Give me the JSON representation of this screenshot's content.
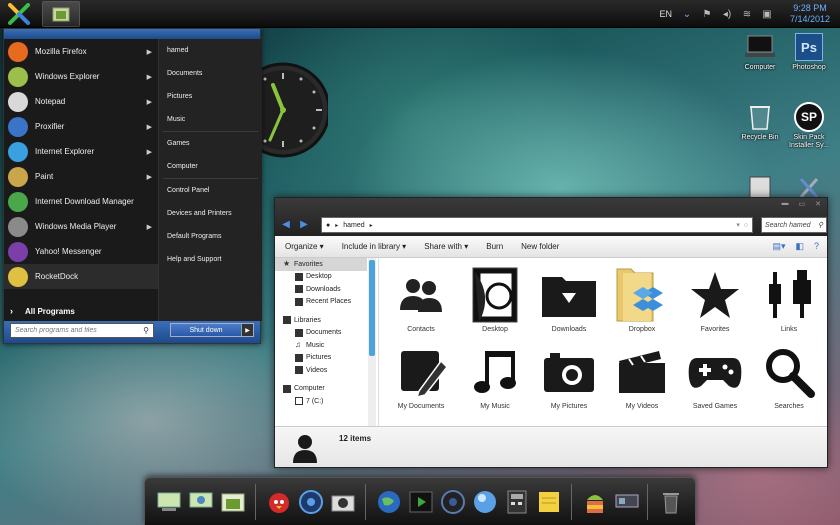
{
  "taskbar": {
    "start_icon": "colorful-x-icon",
    "app_icon": "folder-icon"
  },
  "tray": {
    "language": "EN",
    "time": "9:28 PM",
    "date": "7/14/2012"
  },
  "start_menu": {
    "programs": [
      {
        "label": "Mozilla Firefox",
        "icon": "firefox-icon",
        "color": "#e66a1f",
        "arrow": true
      },
      {
        "label": "Windows Explorer",
        "icon": "explorer-icon",
        "color": "#9bbf4a",
        "arrow": true
      },
      {
        "label": "Notepad",
        "icon": "notepad-icon",
        "color": "#d9d9d9",
        "arrow": true
      },
      {
        "label": "Proxifier",
        "icon": "proxifier-icon",
        "color": "#3a74c7",
        "arrow": true
      },
      {
        "label": "Internet Explorer",
        "icon": "ie-icon",
        "color": "#3aa0e0",
        "arrow": true
      },
      {
        "label": "Paint",
        "icon": "paint-icon",
        "color": "#c9a64a",
        "arrow": true
      },
      {
        "label": "Internet Download Manager",
        "icon": "idm-icon",
        "color": "#4aa84a",
        "arrow": false
      },
      {
        "label": "Windows Media Player",
        "icon": "wmp-icon",
        "color": "#8a8a8a",
        "arrow": true
      },
      {
        "label": "Yahoo! Messenger",
        "icon": "yahoo-icon",
        "color": "#7a3fa8",
        "arrow": false
      },
      {
        "label": "RocketDock",
        "icon": "rocketdock-icon",
        "color": "#e0c040",
        "arrow": false
      }
    ],
    "all_programs": "All Programs",
    "places": [
      "hamed",
      "Documents",
      "Pictures",
      "Music",
      "Games",
      "Computer",
      "Control Panel",
      "Devices and Printers",
      "Default Programs",
      "Help and Support"
    ],
    "search_placeholder": "Search programs and files",
    "shutdown_label": "Shut down"
  },
  "desktop_icons": [
    {
      "label": "Computer",
      "icon": "laptop-icon"
    },
    {
      "label": "Photoshop",
      "icon": "photoshop-icon",
      "short": "Ps"
    },
    {
      "label": "Recycle Bin",
      "icon": "recycle-bin-icon"
    },
    {
      "label": "Skin Pack Installer Sy...",
      "icon": "skinpack-icon",
      "short": "SP"
    }
  ],
  "explorer": {
    "address_user": "hamed",
    "search_placeholder": "Search hamed",
    "commands": [
      "Organize ▾",
      "Include in library ▾",
      "Share with ▾",
      "Burn",
      "New folder"
    ],
    "nav_pane": {
      "favorites": "Favorites",
      "favorites_items": [
        "Desktop",
        "Downloads",
        "Recent Places"
      ],
      "libraries": "Libraries",
      "libraries_items": [
        "Documents",
        "Music",
        "Pictures",
        "Videos"
      ],
      "computer": "Computer",
      "computer_items": [
        "7 (C:)"
      ]
    },
    "items": [
      {
        "label": "Contacts",
        "icon": "contacts-icon"
      },
      {
        "label": "Desktop",
        "icon": "desktop-folder-icon"
      },
      {
        "label": "Downloads",
        "icon": "downloads-icon"
      },
      {
        "label": "Dropbox",
        "icon": "dropbox-icon"
      },
      {
        "label": "Favorites",
        "icon": "favorites-star-icon"
      },
      {
        "label": "Links",
        "icon": "links-icon"
      },
      {
        "label": "My Documents",
        "icon": "documents-icon"
      },
      {
        "label": "My Music",
        "icon": "music-icon"
      },
      {
        "label": "My Pictures",
        "icon": "pictures-icon"
      },
      {
        "label": "My Videos",
        "icon": "videos-icon"
      },
      {
        "label": "Saved Games",
        "icon": "games-icon"
      },
      {
        "label": "Searches",
        "icon": "search-icon"
      }
    ],
    "status": "12 items"
  },
  "dock": {
    "items": [
      "computer-dock-icon",
      "network-dock-icon",
      "folder-dock-icon",
      "angry-birds-icon",
      "browser-dock-icon",
      "camera-dock-icon",
      "globe-dock-icon",
      "media-player-dock-icon",
      "speaker-dock-icon",
      "orb-dock-icon",
      "calculator-dock-icon",
      "notes-dock-icon",
      "android-dock-icon",
      "display-dock-icon",
      "trash-dock-icon"
    ]
  }
}
